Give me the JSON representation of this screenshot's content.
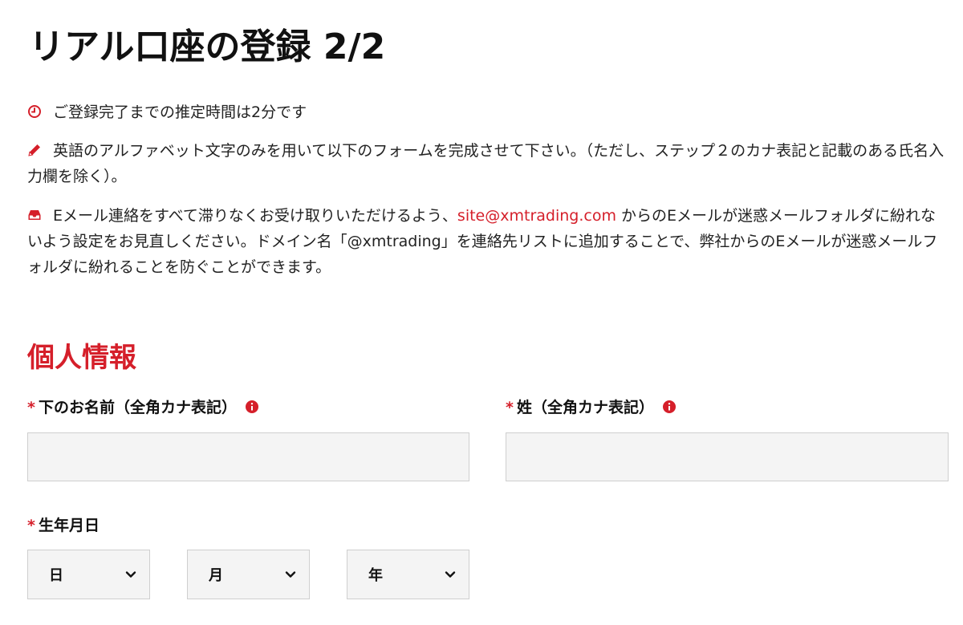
{
  "page": {
    "title": "リアル口座の登録 2/2"
  },
  "info": {
    "estimate_text": "ご登録完了までの推定時間は2分です",
    "english_text": "英語のアルファベット文字のみを用いて以下のフォームを完成させて下さい。（ただし、ステップ２のカナ表記と記載のある氏名入力欄を除く）。",
    "email_before": "Eメール連絡をすべて滞りなくお受け取りいただけるよう、",
    "email_link": "site@xmtrading.com",
    "email_after": " からのEメールが迷惑メールフォルダに紛れないよう設定をお見直しください。ドメイン名「@xmtrading」を連絡先リストに追加することで、弊社からのEメールが迷惑メールフォルダに紛れることを防ぐことができます。",
    "icons": [
      "clock-icon",
      "pencil-icon",
      "inbox-icon"
    ]
  },
  "section": {
    "title": "個人情報"
  },
  "form": {
    "required_mark": "*",
    "first_name_label": "下のお名前（全角カナ表記）",
    "first_name_value": "",
    "last_name_label": "姓（全角カナ表記）",
    "last_name_value": "",
    "dob_label": "生年月日",
    "day_value": "日",
    "month_value": "月",
    "year_value": "年"
  },
  "colors": {
    "accent": "#d51f2a",
    "input_bg": "#f4f4f4",
    "input_border": "#cfcfcf",
    "text": "#1a1a1a"
  }
}
